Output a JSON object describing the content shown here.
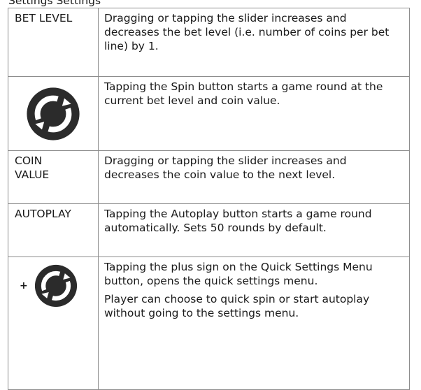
{
  "header_cutoff": "Settings Settings",
  "rows": [
    {
      "label": "BET LEVEL",
      "text": "Dragging or tapping the slider increases and decreases the bet level (i.e. number of coins per bet line) by 1."
    },
    {
      "icon": "spin-icon",
      "text": "Tapping the Spin button starts a game round at the current bet level and coin value."
    },
    {
      "label": "COIN VALUE",
      "text": "Dragging or tapping the slider increases and decreases the coin value to the next level."
    },
    {
      "label": "AUTOPLAY",
      "text": "Tapping the Autoplay button starts a game round automatically. Sets 50 rounds by default."
    },
    {
      "icon": "quick-settings-spin-icon",
      "plus": "+",
      "text": "Tapping the plus sign on the Quick Settings Menu button, opens the quick settings menu.",
      "text2": "Player can choose to quick spin or start autoplay without going to the settings menu."
    }
  ],
  "colors": {
    "icon_dark": "#2b2b2b",
    "border": "#8c8c8c",
    "text": "#1a1a1a"
  }
}
